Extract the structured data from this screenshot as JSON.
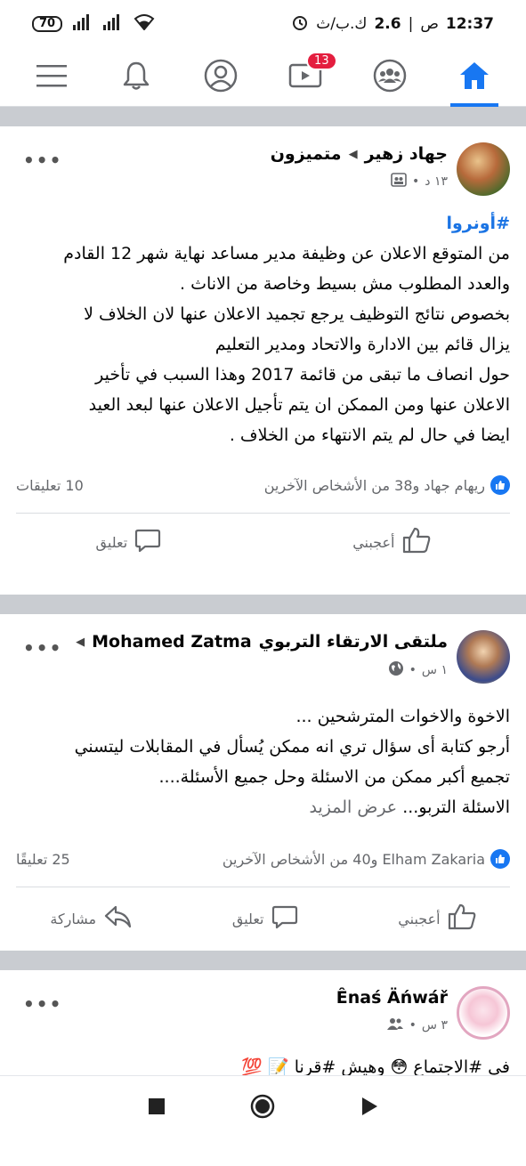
{
  "status_bar": {
    "battery": "70",
    "time": "12:37",
    "am_pm": "ص",
    "speed": "2.6",
    "speed_unit": "ك.ب/ث"
  },
  "nav": {
    "items": [
      "menu-icon",
      "bell-icon",
      "profile-icon",
      "watch-icon",
      "groups-icon",
      "home-icon"
    ],
    "watch_badge": "13",
    "active": "home",
    "accent": "#1877f2"
  },
  "posts": [
    {
      "group": "متميزون",
      "author": "جهاد زهير",
      "time": "١٣ د",
      "hashtag": "#أونروا",
      "body_lines": [
        "من المتوقع الاعلان عن وظيفة مدير مساعد نهاية شهر 12 القادم",
        "والعدد المطلوب مش بسيط وخاصة من الاناث .",
        "بخصوص نتائج التوظيف يرجع تجميد الاعلان عنها لان الخلاف لا",
        "يزال قائم  بين الادارة والاتحاد ومدير التعليم",
        " حول انصاف ما تبقى من قائمة 2017 وهذا السبب في تأخير",
        "الاعلان عنها ومن الممكن ان يتم تأجيل الاعلان عنها لبعد العيد",
        "ايضا في حال لم يتم الانتهاء من الخلاف ."
      ],
      "reactions_text": "ريهام جهاد و38 من الأشخاص الآخرين",
      "comments": "10 تعليقات",
      "like_label": "أعجبني",
      "comment_label": "تعليق"
    },
    {
      "group": "ملتقى الارتقاء التربوي",
      "author": "Mohamed Zatma",
      "time": "١ س",
      "body_lines": [
        "الاخوة والاخوات المترشحين ...",
        "أرجو كتابة أى سؤال تري انه ممكن يُسأل في المقابلات ليتسني",
        "تجميع أكبر ممكن من الاسئلة وحل جميع الأسئلة...."
      ],
      "last_line": "الاسئلة التربو...",
      "see_more": "عرض المزيد",
      "reactions_text": "Elham Zakaria و40 من الأشخاص الآخرين",
      "comments": "25 تعليقًا",
      "like_label": "أعجبني",
      "comment_label": "تعليق",
      "share_label": "مشاركة"
    },
    {
      "author": "Ênaś Äńwář",
      "time": "٣ س",
      "partial_text": "في #الاجتماع 😳 وهيش #قرنا 📝 💯"
    }
  ]
}
